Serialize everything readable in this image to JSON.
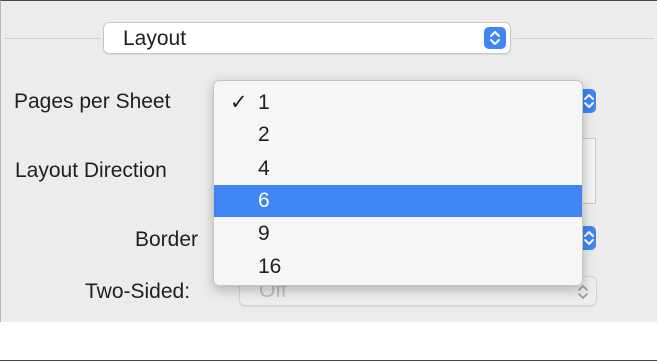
{
  "section_popup": {
    "value": "Layout"
  },
  "rows": {
    "pages_per_sheet_label": "Pages per Sheet",
    "layout_direction_label": "Layout Direction",
    "border_label": "Border",
    "two_sided_label": "Two-Sided:"
  },
  "two_sided_popup": {
    "value": "Off",
    "enabled": false
  },
  "pages_per_sheet_menu": {
    "items": [
      {
        "label": "1",
        "checked": true
      },
      {
        "label": "2",
        "checked": false
      },
      {
        "label": "4",
        "checked": false
      },
      {
        "label": "6",
        "checked": false,
        "highlighted": true
      },
      {
        "label": "9",
        "checked": false
      },
      {
        "label": "16",
        "checked": false
      }
    ],
    "check_glyph": "✓"
  },
  "colors": {
    "accent": "#3f86f4",
    "panel_background": "#ececec",
    "menu_background": "#f6f6f6",
    "disabled_text": "#bdbdbd"
  }
}
